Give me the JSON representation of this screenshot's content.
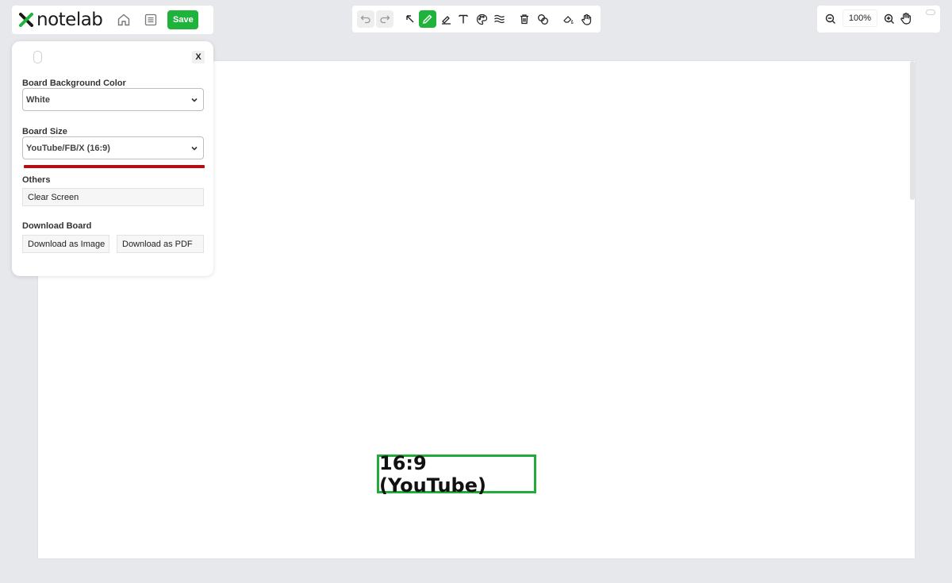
{
  "app": {
    "name": "notelab",
    "brand_color": "#1fb33c",
    "logo_mark_color": "#1a1a1a"
  },
  "header": {
    "home_icon": "home-icon",
    "notes_icon": "notes-icon",
    "save_label": "Save"
  },
  "toolbar": {
    "tools": [
      {
        "name": "undo",
        "icon": "undo-icon",
        "state": "disabled"
      },
      {
        "name": "redo",
        "icon": "redo-icon",
        "state": "disabled"
      },
      {
        "name": "select",
        "icon": "arrow-select-icon",
        "state": "normal"
      },
      {
        "name": "pen",
        "icon": "pen-icon",
        "state": "active"
      },
      {
        "name": "highlighter",
        "icon": "highlighter-icon",
        "state": "normal"
      },
      {
        "name": "text",
        "icon": "text-icon",
        "state": "normal"
      },
      {
        "name": "color",
        "icon": "palette-icon",
        "state": "normal"
      },
      {
        "name": "stroke",
        "icon": "stroke-width-icon",
        "state": "normal"
      },
      {
        "name": "delete",
        "icon": "trash-icon",
        "state": "normal"
      },
      {
        "name": "shapes",
        "icon": "shapes-icon",
        "state": "normal"
      },
      {
        "name": "eraser",
        "icon": "eraser-icon",
        "state": "normal"
      },
      {
        "name": "pan",
        "icon": "hand-icon",
        "state": "normal"
      }
    ]
  },
  "zoom": {
    "value": "100%",
    "zoom_out_icon": "zoom-out-icon",
    "zoom_in_icon": "zoom-in-icon",
    "pan_icon": "hand-icon"
  },
  "settings": {
    "close_label": "X",
    "background_label": "Board Background Color",
    "background_value": "White",
    "size_label": "Board Size",
    "size_value": "YouTube/FB/X (16:9)",
    "others_label": "Others",
    "clear_label": "Clear Screen",
    "download_label": "Download Board",
    "download_image_label": "Download as Image",
    "download_pdf_label": "Download as PDF"
  },
  "board": {
    "background": "#ffffff",
    "annotation_text": "16:9 (YouTube)",
    "annotation_border_color": "#22aa3a"
  }
}
